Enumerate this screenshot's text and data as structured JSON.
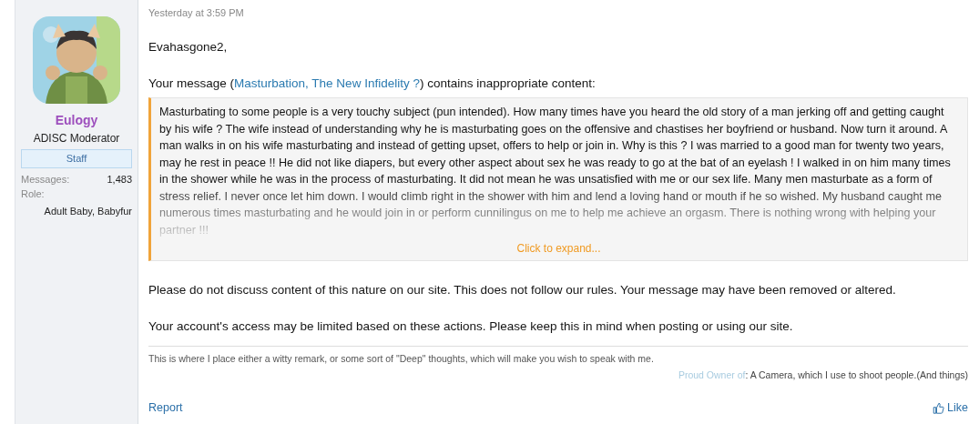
{
  "user": {
    "name": "Eulogy",
    "title": "ADISC Moderator",
    "banner": "Staff",
    "stats": [
      {
        "label": "Messages:",
        "value": "1,483"
      }
    ],
    "role": {
      "label": "Role:",
      "value": "Adult Baby, Babyfur"
    }
  },
  "post": {
    "timestamp": "Yesterday at 3:59 PM",
    "greeting": "Evahasgone2,",
    "intro": {
      "before": "Your message (",
      "link": "Masturbation, The New Infidelity ?",
      "after": ") contains inappropriate content:"
    },
    "quote": {
      "text": "Masturbating to some people is a very touchy subject (pun intended). How many times have you heard the old story of a man jerking off and getting caught by his wife ? The wife instead of understanding why he is masturbating goes on the offensive and chastises her boyfriend or husband. Now turn it around. A man walks in on his wife masturbating and instead of getting upset, offers to help or join in. Why is this ? I was married to a good man for twenty two years, may he rest in peace !! He did not like diapers, but every other aspect about sex he was ready to go at the bat of an eyelash ! I walked in on him many times in the shower while he was in the process of masturbating. It did not mean he was unsatisfied with me or our sex life. Many men masturbate as a form of stress relief. I never once let him down. I would climb right in the shower with him and lend a loving hand or mouth if he so wished. My husband caught me numerous times masturbating and he would join in or perform cunnilingus on me to help me achieve an orgasm. There is nothing wrong with helping your partner !!!",
      "expand_label": "Click to expand..."
    },
    "paragraphs": [
      "Please do not discuss content of this nature on our site. This does not follow our rules. Your message may have been removed or altered.",
      "Your account's access may be limited based on these actions. Please keep this in mind when posting or using our site."
    ],
    "signature": {
      "text": "This is where I place either a witty remark, or some sort of \"Deep\" thoughts, which will make you wish to speak with me.",
      "field_label": "Proud Owner of",
      "field_value": ": A Camera, which I use to shoot people.(And things)"
    },
    "actions": {
      "report": "Report",
      "like": "Like"
    }
  }
}
